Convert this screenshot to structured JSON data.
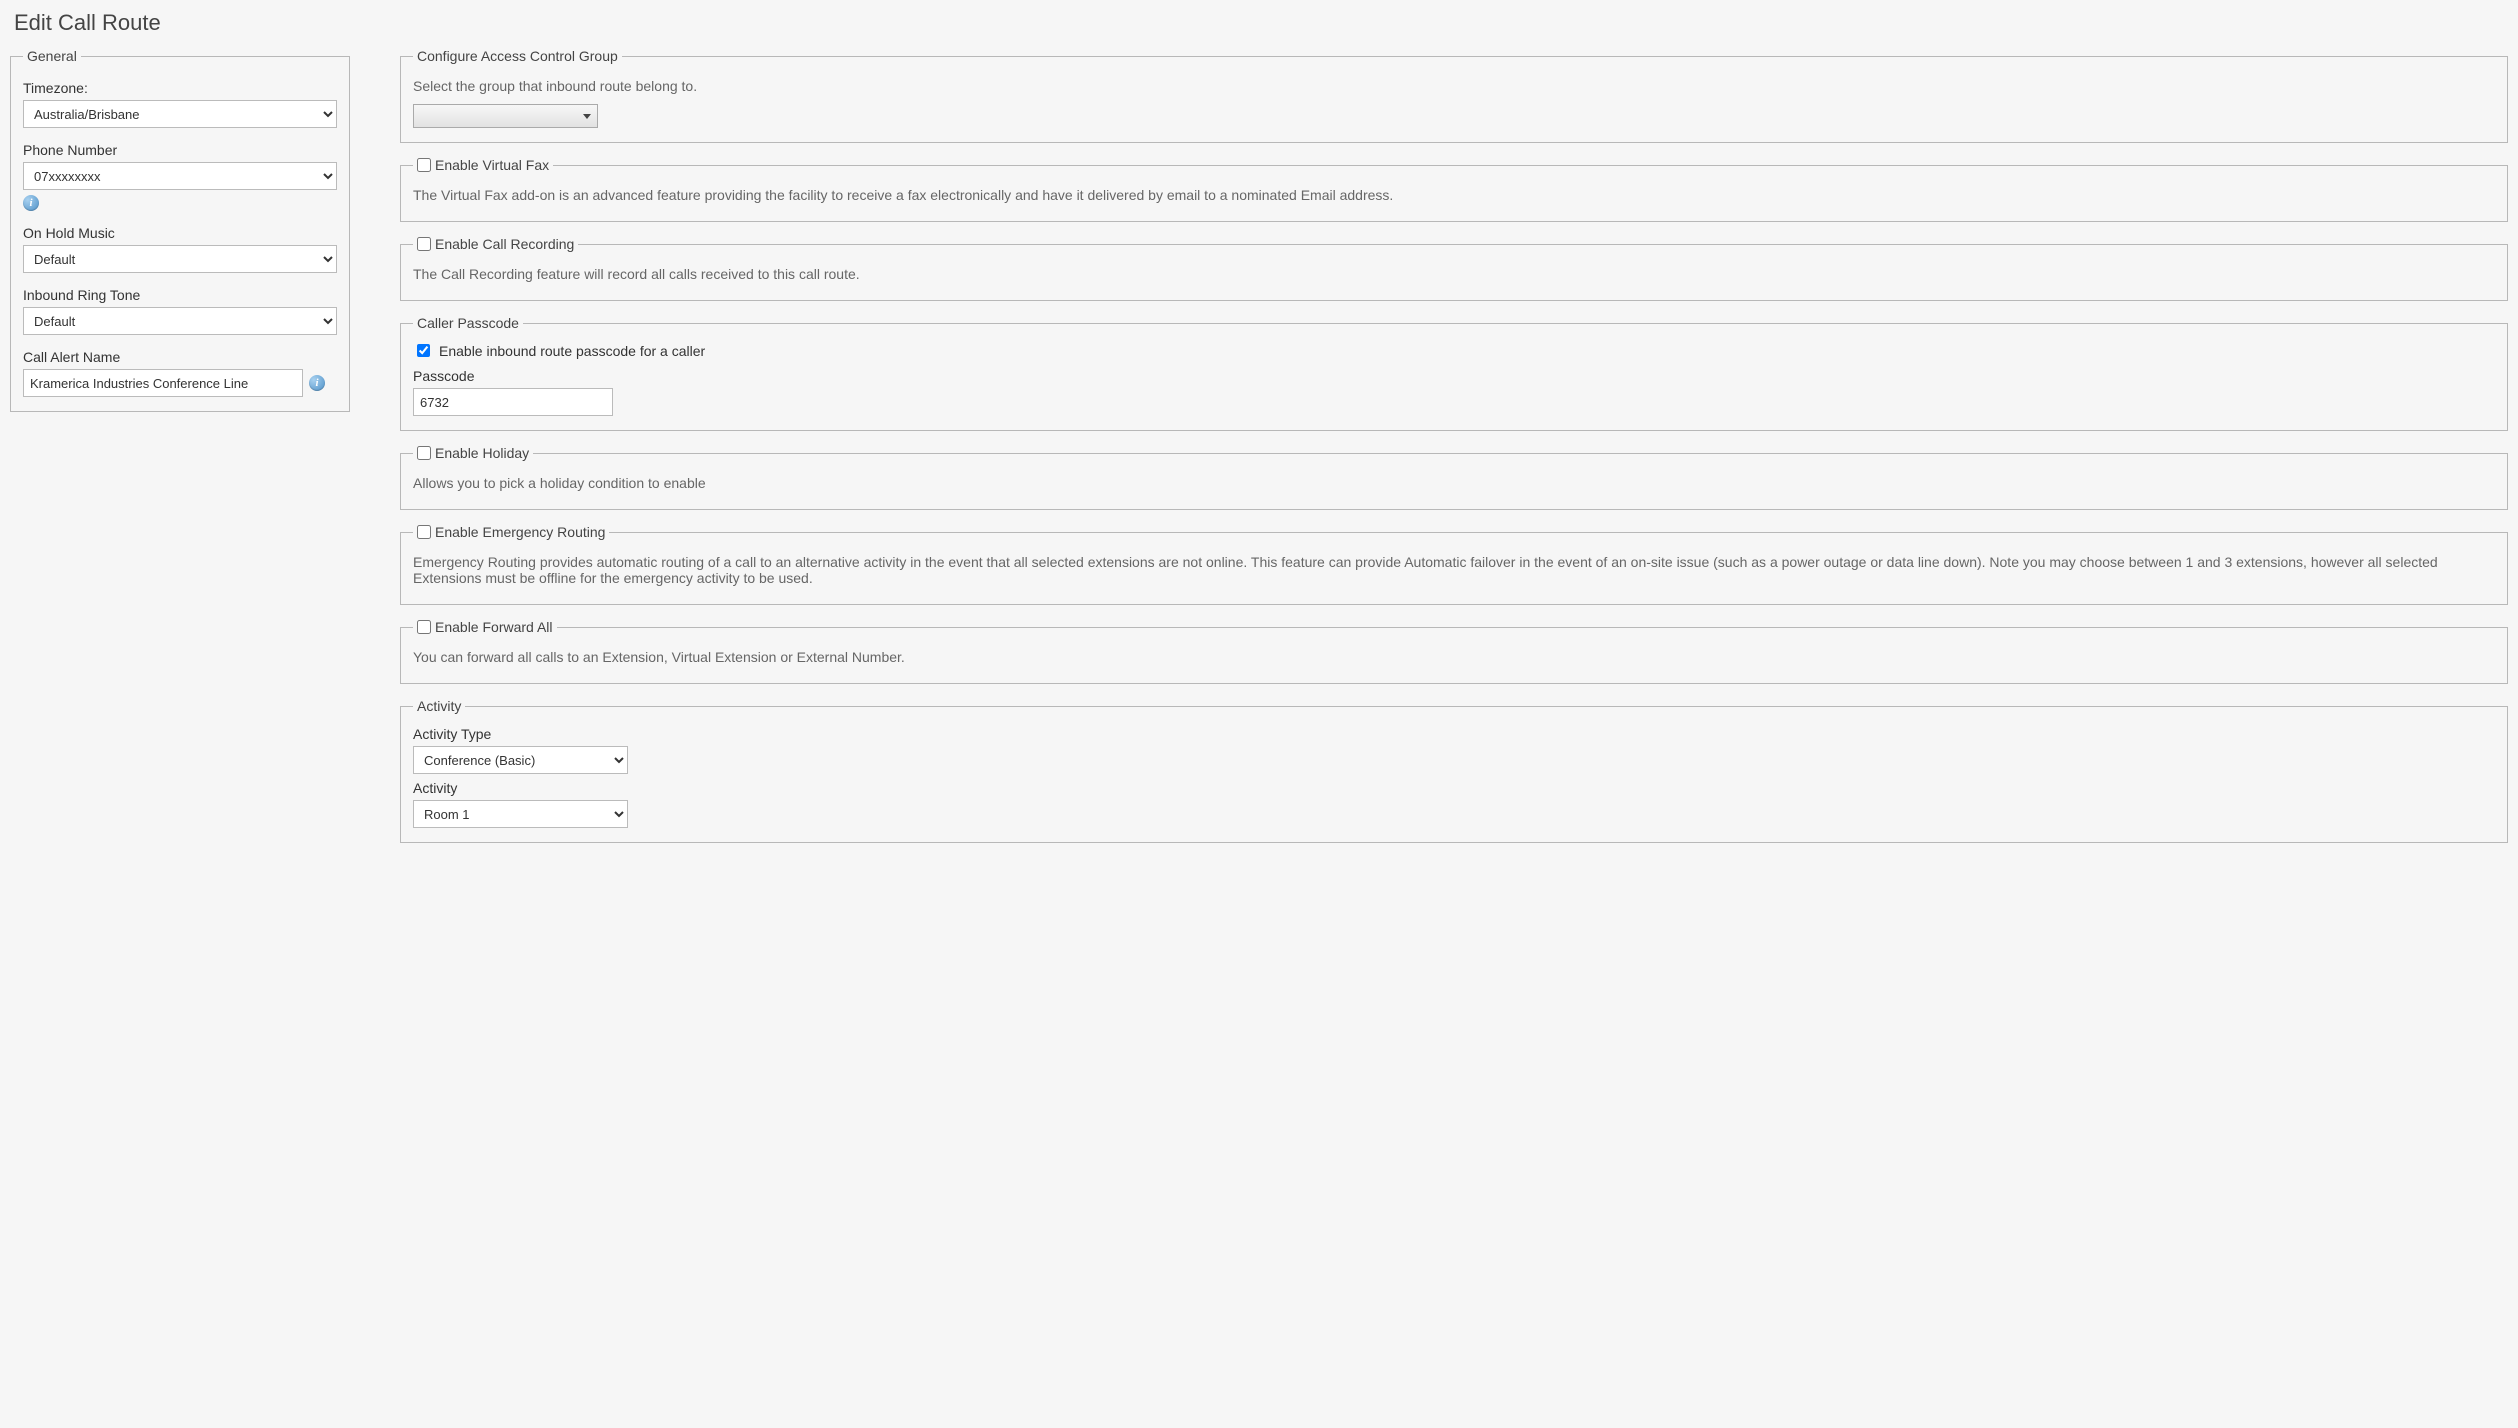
{
  "page_title": "Edit Call Route",
  "general": {
    "legend": "General",
    "timezone_label": "Timezone:",
    "timezone_value": "Australia/Brisbane",
    "phone_label": "Phone Number",
    "phone_value": "07xxxxxxxx",
    "hold_music_label": "On Hold Music",
    "hold_music_value": "Default",
    "ring_tone_label": "Inbound Ring Tone",
    "ring_tone_value": "Default",
    "alert_name_label": "Call Alert Name",
    "alert_name_value": "Kramerica Industries Conference Line"
  },
  "acg": {
    "legend": "Configure Access Control Group",
    "desc": "Select the group that inbound route belong to.",
    "value": ""
  },
  "vfax": {
    "legend": "Enable Virtual Fax",
    "checked": false,
    "desc": "The Virtual Fax add-on is an advanced feature providing the facility to receive a fax electronically and have it delivered by email to a nominated Email address."
  },
  "recording": {
    "legend": "Enable Call Recording",
    "checked": false,
    "desc": "The Call Recording feature will record all calls received to this call route."
  },
  "passcode": {
    "legend": "Caller Passcode",
    "enable_label": "Enable inbound route passcode for a caller",
    "enable_checked": true,
    "passcode_label": "Passcode",
    "passcode_value": "6732"
  },
  "holiday": {
    "legend": "Enable Holiday",
    "checked": false,
    "desc": "Allows you to pick a holiday condition to enable"
  },
  "emergency": {
    "legend": "Enable Emergency Routing",
    "checked": false,
    "desc": "Emergency Routing provides automatic routing of a call to an alternative activity in the event that all selected extensions are not online. This feature can provide Automatic failover in the event of an on-site issue (such as a power outage or data line down). Note you may choose between 1 and 3 extensions, however all selected Extensions must be offline for the emergency activity to be used."
  },
  "forward": {
    "legend": "Enable Forward All",
    "checked": false,
    "desc": "You can forward all calls to an Extension, Virtual Extension or External Number."
  },
  "activity": {
    "legend": "Activity",
    "type_label": "Activity Type",
    "type_value": "Conference (Basic)",
    "activity_label": "Activity",
    "activity_value": "Room 1"
  }
}
